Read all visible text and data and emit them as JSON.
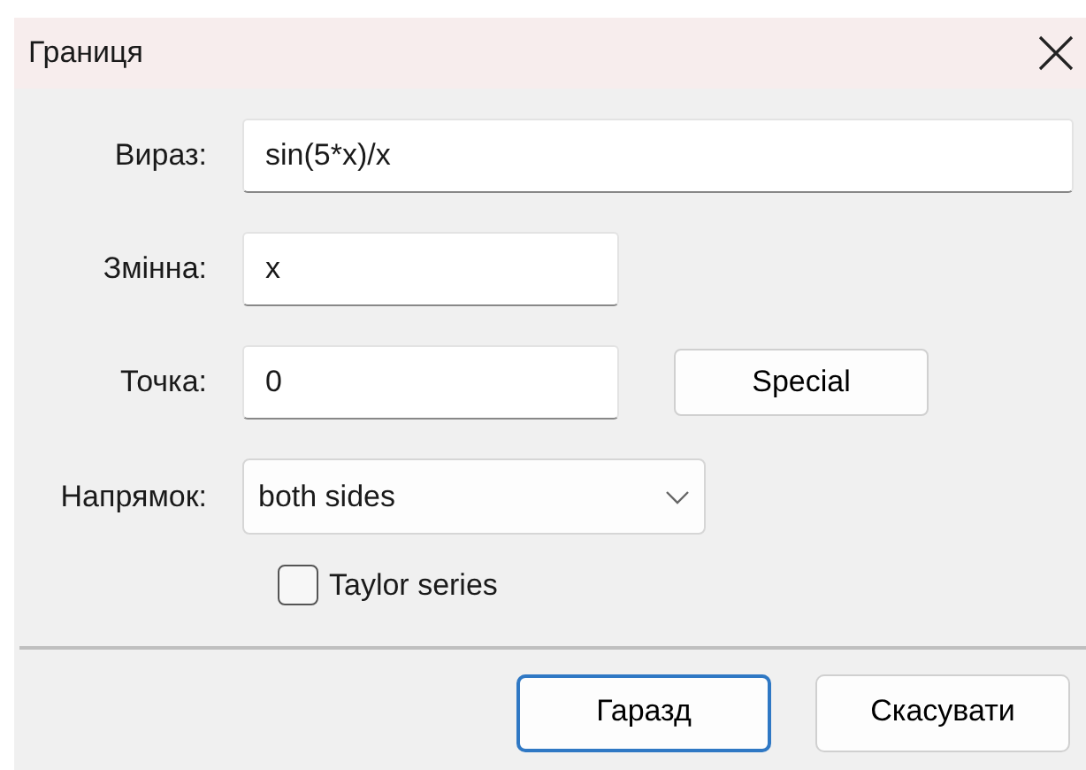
{
  "window": {
    "title": "Границя"
  },
  "fields": [
    {
      "kind": "text",
      "label": "Вираз:",
      "value": "sin(5*x)/x",
      "wide": true
    },
    {
      "kind": "text",
      "label": "Змінна:",
      "value": "x",
      "wide": false
    },
    {
      "kind": "text",
      "label": "Точка:",
      "value": "0",
      "wide": false,
      "button": "Special"
    },
    {
      "kind": "select",
      "label": "Напрямок:",
      "value": "both sides"
    }
  ],
  "taylor_series": {
    "label": "Taylor series",
    "checked": false
  },
  "buttons": [
    {
      "label": "Гаразд",
      "default": true
    },
    {
      "label": "Скасувати",
      "default": false
    }
  ]
}
